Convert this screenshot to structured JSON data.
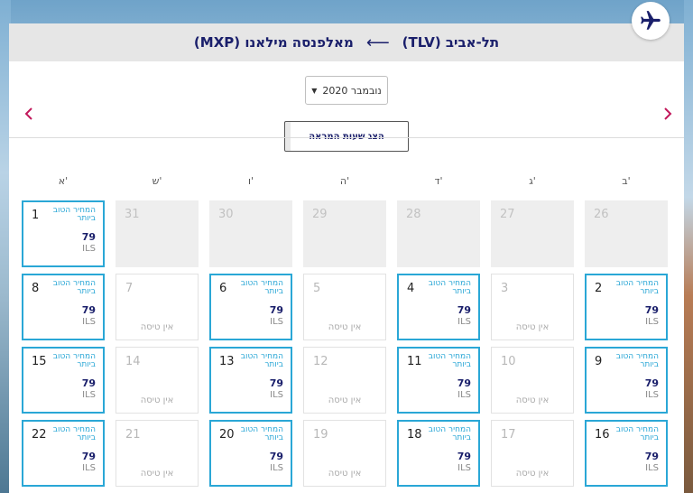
{
  "header": {
    "origin": "תל-אביב (TLV)",
    "arrow": "⟵",
    "destination": "מאלפנסה מילאנו (MXP)"
  },
  "icons": {
    "plane": "airplane-icon",
    "prev": "chevron-left-icon",
    "next": "chevron-right-icon",
    "caret": "caret-down-icon"
  },
  "month_select": {
    "value": "נובמבר 2020"
  },
  "show_times_button": {
    "label": "הצג שעות המראה"
  },
  "weekdays": [
    "א'",
    "ש'",
    "ו'",
    "ה'",
    "ד'",
    "ג'",
    "ב'"
  ],
  "labels": {
    "best_price": "המחיר הטוב ביותר",
    "no_flight": "אין טיסה",
    "price": "79",
    "currency": "ILS"
  },
  "weeks": [
    [
      {
        "day": "1",
        "status": "available"
      },
      {
        "day": "31",
        "status": "past"
      },
      {
        "day": "30",
        "status": "past"
      },
      {
        "day": "29",
        "status": "past"
      },
      {
        "day": "28",
        "status": "past"
      },
      {
        "day": "27",
        "status": "past"
      },
      {
        "day": "26",
        "status": "past"
      }
    ],
    [
      {
        "day": "8",
        "status": "available"
      },
      {
        "day": "7",
        "status": "none"
      },
      {
        "day": "6",
        "status": "available"
      },
      {
        "day": "5",
        "status": "none"
      },
      {
        "day": "4",
        "status": "available"
      },
      {
        "day": "3",
        "status": "none"
      },
      {
        "day": "2",
        "status": "available"
      }
    ],
    [
      {
        "day": "15",
        "status": "available"
      },
      {
        "day": "14",
        "status": "none"
      },
      {
        "day": "13",
        "status": "available"
      },
      {
        "day": "12",
        "status": "none"
      },
      {
        "day": "11",
        "status": "available"
      },
      {
        "day": "10",
        "status": "none"
      },
      {
        "day": "9",
        "status": "available"
      }
    ],
    [
      {
        "day": "22",
        "status": "available"
      },
      {
        "day": "21",
        "status": "none"
      },
      {
        "day": "20",
        "status": "available"
      },
      {
        "day": "19",
        "status": "none"
      },
      {
        "day": "18",
        "status": "available"
      },
      {
        "day": "17",
        "status": "none"
      },
      {
        "day": "16",
        "status": "available"
      }
    ]
  ],
  "colors": {
    "accent": "#2aa7d6",
    "brand_navy": "#1a1f6b",
    "nav_arrow": "#c2185b"
  }
}
